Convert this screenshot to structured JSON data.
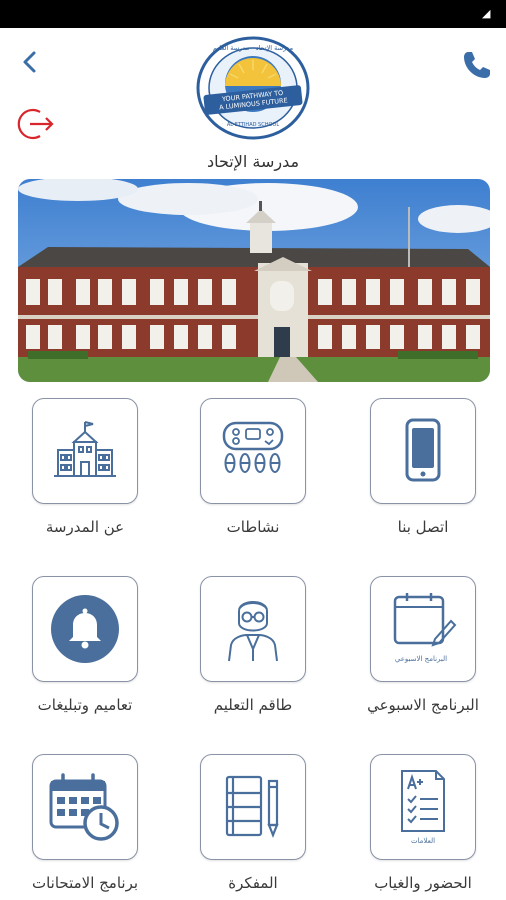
{
  "header": {
    "school_name": "مدرسة الإتحاد",
    "logo": {
      "arc_text": "مدرسة الإتحاد - مدرسة العليم",
      "ribbon_line1": "YOUR PATHWAY TO",
      "ribbon_line2": "A LUMINOUS FUTURE",
      "bottom_text": "AL-ETTIHAD SCHOOL"
    },
    "icons": {
      "back": "chevron-left-icon",
      "phone": "phone-icon",
      "logout": "logout-icon"
    }
  },
  "hero": {
    "image": "school-building-photo"
  },
  "menu": {
    "row1": [
      {
        "label": "اتصل بنا",
        "icon": "mobile-phone-icon"
      },
      {
        "label": "نشاطات",
        "icon": "activities-icon"
      },
      {
        "label": "عن المدرسة",
        "icon": "school-building-icon"
      }
    ],
    "row2": [
      {
        "label": "البرنامج الاسبوعي",
        "icon": "weekly-schedule-icon",
        "caption": "البرنامج الاسبوعي"
      },
      {
        "label": "طاقم التعليم",
        "icon": "teacher-icon"
      },
      {
        "label": "تعاميم وتبليغات",
        "icon": "bell-icon"
      }
    ],
    "row3": [
      {
        "label": "الحضور والغياب",
        "icon": "grades-checklist-icon",
        "caption": "العلامات"
      },
      {
        "label": "المفكرة",
        "icon": "notebook-icon"
      },
      {
        "label": "برنامج الامتحانات",
        "icon": "calendar-clock-icon"
      }
    ]
  },
  "colors": {
    "accent": "#3b6ea8",
    "icon_stroke": "#4a6f9c",
    "logout": "#d9262c",
    "tile_border": "#8a93a6"
  }
}
